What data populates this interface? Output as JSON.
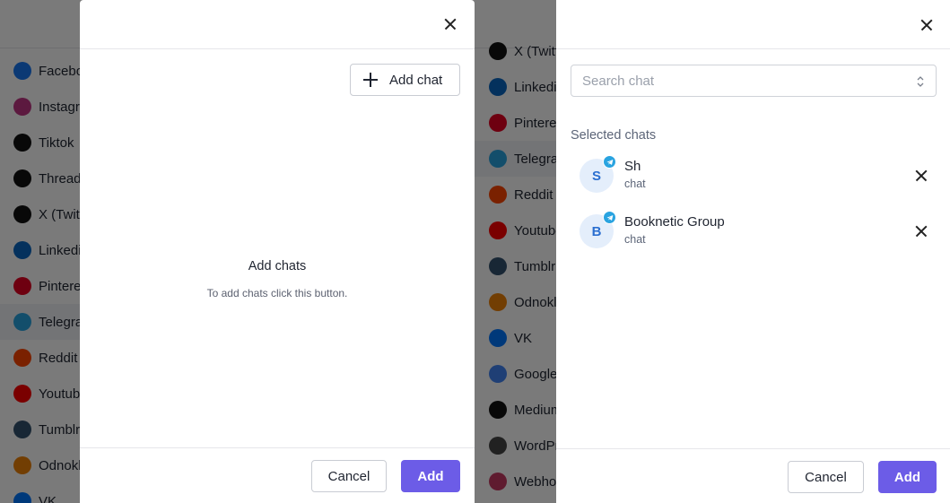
{
  "background": {
    "left_items": [
      {
        "label": "Facebook",
        "icon": "facebook-icon",
        "color": "#1877f2"
      },
      {
        "label": "Instagram",
        "icon": "instagram-icon",
        "color": "#c13584"
      },
      {
        "label": "Tiktok",
        "icon": "tiktok-icon",
        "color": "#111111"
      },
      {
        "label": "Threads",
        "icon": "threads-icon",
        "color": "#111111"
      },
      {
        "label": "X (Twitter)",
        "icon": "x-icon",
        "color": "#111111"
      },
      {
        "label": "Linkedin",
        "icon": "linkedin-icon",
        "color": "#0a66c2"
      },
      {
        "label": "Pinterest",
        "icon": "pinterest-icon",
        "color": "#e60023"
      },
      {
        "label": "Telegram",
        "icon": "telegram-icon",
        "color": "#29a3e0"
      },
      {
        "label": "Reddit",
        "icon": "reddit-icon",
        "color": "#ff4500"
      },
      {
        "label": "Youtube",
        "icon": "youtube-icon",
        "color": "#ff0000"
      },
      {
        "label": "Tumblr",
        "icon": "tumblr-icon",
        "color": "#34526f"
      },
      {
        "label": "Odnoklassniki",
        "icon": "odnoklassniki-icon",
        "color": "#ee8208"
      },
      {
        "label": "VK",
        "icon": "vk-icon",
        "color": "#0077ff"
      }
    ],
    "mid_items": [
      {
        "label": "X (Twitter)",
        "icon": "x-icon",
        "color": "#111111"
      },
      {
        "label": "Linkedin",
        "icon": "linkedin-icon",
        "color": "#0a66c2"
      },
      {
        "label": "Pinterest",
        "icon": "pinterest-icon",
        "color": "#e60023"
      },
      {
        "label": "Telegram",
        "icon": "telegram-icon",
        "color": "#29a3e0"
      },
      {
        "label": "Reddit",
        "icon": "reddit-icon",
        "color": "#ff4500"
      },
      {
        "label": "Youtube",
        "icon": "youtube-icon",
        "color": "#ff0000"
      },
      {
        "label": "Tumblr",
        "icon": "tumblr-icon",
        "color": "#34526f"
      },
      {
        "label": "Odnoklassniki",
        "icon": "odnoklassniki-icon",
        "color": "#ee8208"
      },
      {
        "label": "VK",
        "icon": "vk-icon",
        "color": "#0077ff"
      },
      {
        "label": "Google",
        "icon": "google-business-icon",
        "color": "#4285f4"
      },
      {
        "label": "Medium",
        "icon": "medium-icon",
        "color": "#111111"
      },
      {
        "label": "WordPress",
        "icon": "wordpress-icon",
        "color": "#464646"
      },
      {
        "label": "Webhook",
        "icon": "webhook-icon",
        "color": "#c73a63"
      }
    ]
  },
  "left_modal": {
    "add_chat_label": "Add chat",
    "empty_title": "Add chats",
    "empty_subtitle": "To add chats click this button.",
    "cancel_label": "Cancel",
    "add_label": "Add"
  },
  "right_modal": {
    "search_placeholder": "Search chat",
    "section_label": "Selected chats",
    "chats": [
      {
        "initial": "S",
        "name": "Sh",
        "type": "chat"
      },
      {
        "initial": "B",
        "name": "Booknetic Group",
        "type": "chat"
      }
    ],
    "cancel_label": "Cancel",
    "add_label": "Add"
  },
  "colors": {
    "accent": "#6c5ce7",
    "telegram": "#29a3e0",
    "avatar_bg": "#e4eefb",
    "avatar_text": "#2b6fd0"
  }
}
